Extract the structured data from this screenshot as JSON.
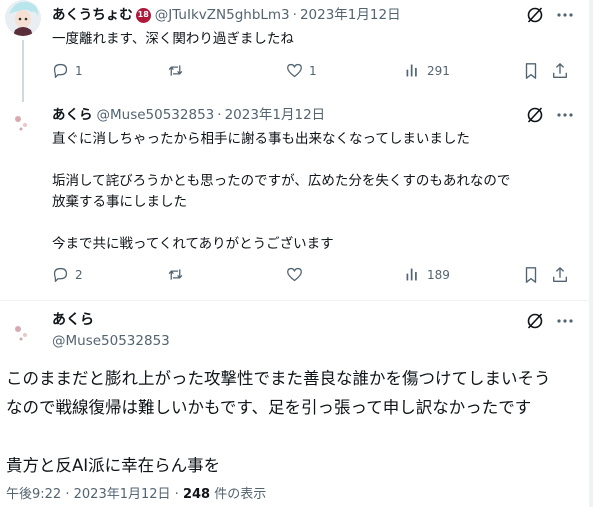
{
  "tweets": [
    {
      "name": "あくうちょむ",
      "badge": "18",
      "handle": "@JTuIkvZN5ghbLm3",
      "date": "2023年1月12日",
      "text": "一度離れます、深く関わり過ぎましたね",
      "replies": "1",
      "retweets": "",
      "likes": "1",
      "views": "291"
    },
    {
      "name": "あくら",
      "handle": "@Muse50532853",
      "date": "2023年1月12日",
      "text": "直ぐに消しちゃったから相手に謝る事も出来なくなってしまいました\n\n垢消して詫びろうかとも思ったのですが、広めた分を失くすのもあれなので\n放棄する事にしました\n\n今まで共に戦ってくれてありがとうございます",
      "replies": "2",
      "retweets": "",
      "likes": "",
      "views": "189"
    }
  ],
  "main": {
    "name": "あくら",
    "handle": "@Muse50532853",
    "text": "このままだと膨れ上がった攻撃性でまた善良な誰かを傷つけてしまいそう\nなので戦線復帰は難しいかもです、足を引っ張って申し訳なかったです\n\n貴方と反AI派に幸在らん事を",
    "time": "午後9:22",
    "date": "2023年1月12日",
    "views_count": "248",
    "views_label": "件の表示"
  },
  "separator": "·",
  "icons": [
    "grok-icon",
    "more-icon",
    "reply-icon",
    "retweet-icon",
    "like-icon",
    "views-icon",
    "bookmark-icon",
    "share-icon"
  ],
  "colors": {
    "text": "#0f1419",
    "muted": "#536471",
    "badge": "#b0183a",
    "divider": "#eff3f4"
  }
}
